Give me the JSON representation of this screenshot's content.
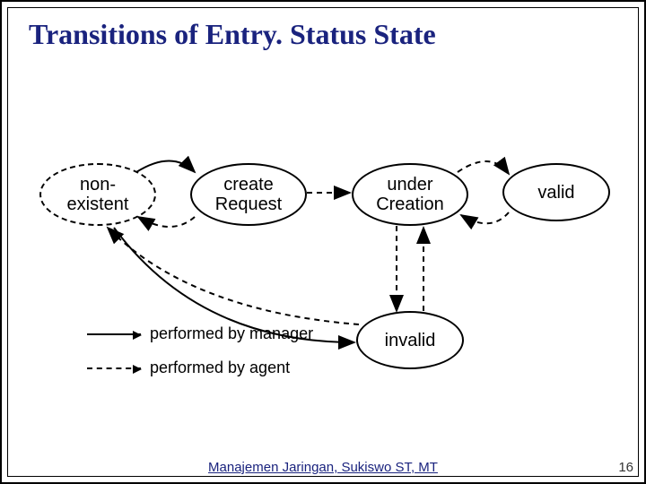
{
  "title": "Transitions of Entry. Status State",
  "states": {
    "nonexistent": {
      "line1": "non-",
      "line2": "existent"
    },
    "create": {
      "line1": "create",
      "line2": "Request"
    },
    "under": {
      "line1": "under",
      "line2": "Creation"
    },
    "valid": {
      "label": "valid"
    },
    "invalid": {
      "label": "invalid"
    }
  },
  "legend": {
    "manager": "performed by manager",
    "agent": "performed by agent"
  },
  "footer": "Manajemen Jaringan, Sukiswo ST, MT",
  "page_number": "16",
  "chart_data": {
    "type": "state-diagram",
    "title": "Transitions of Entry.Status State",
    "states": [
      "non-existent",
      "createRequest",
      "underCreation",
      "valid",
      "invalid"
    ],
    "transitions": [
      {
        "from": "non-existent",
        "to": "createRequest",
        "actor": "manager"
      },
      {
        "from": "createRequest",
        "to": "non-existent",
        "actor": "agent"
      },
      {
        "from": "createRequest",
        "to": "underCreation",
        "actor": "agent"
      },
      {
        "from": "underCreation",
        "to": "valid",
        "actor": "agent"
      },
      {
        "from": "valid",
        "to": "underCreation",
        "actor": "agent"
      },
      {
        "from": "underCreation",
        "to": "invalid",
        "actor": "agent"
      },
      {
        "from": "invalid",
        "to": "underCreation",
        "actor": "agent"
      },
      {
        "from": "non-existent",
        "to": "invalid",
        "actor": "manager"
      },
      {
        "from": "invalid",
        "to": "non-existent",
        "actor": "agent"
      }
    ],
    "legend": {
      "solid-arrow": "performed by manager",
      "dashed-arrow": "performed by agent"
    }
  }
}
